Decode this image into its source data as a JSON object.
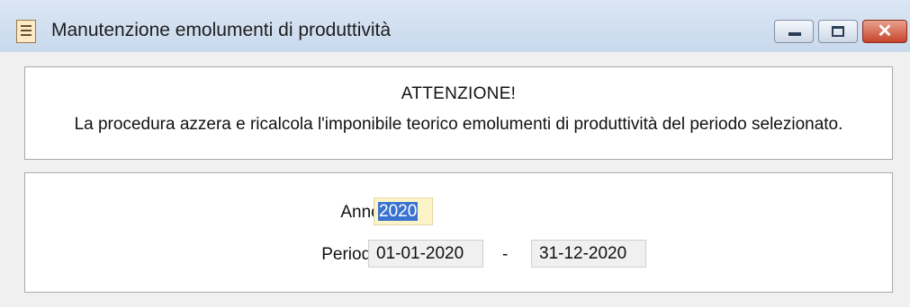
{
  "window": {
    "title": "Manutenzione emolumenti di produttività",
    "controls": {
      "minimize_icon": "minimize-icon",
      "maximize_icon": "maximize-icon",
      "close_icon": "close-icon",
      "close_glyph": "✕"
    }
  },
  "notice": {
    "heading": "ATTENZIONE!",
    "message": "La procedura azzera e ricalcola l'imponibile teorico emolumenti di produttività del periodo selezionato."
  },
  "form": {
    "anno_label": "Anno:",
    "anno_value": "2020",
    "periodo_label": "Periodo:",
    "periodo_from": "01-01-2020",
    "periodo_separator": "-",
    "periodo_to": "31-12-2020"
  },
  "colors": {
    "title_bar": "#d6e3f2",
    "close_button": "#c7432b",
    "selection": "#3a72d0"
  }
}
